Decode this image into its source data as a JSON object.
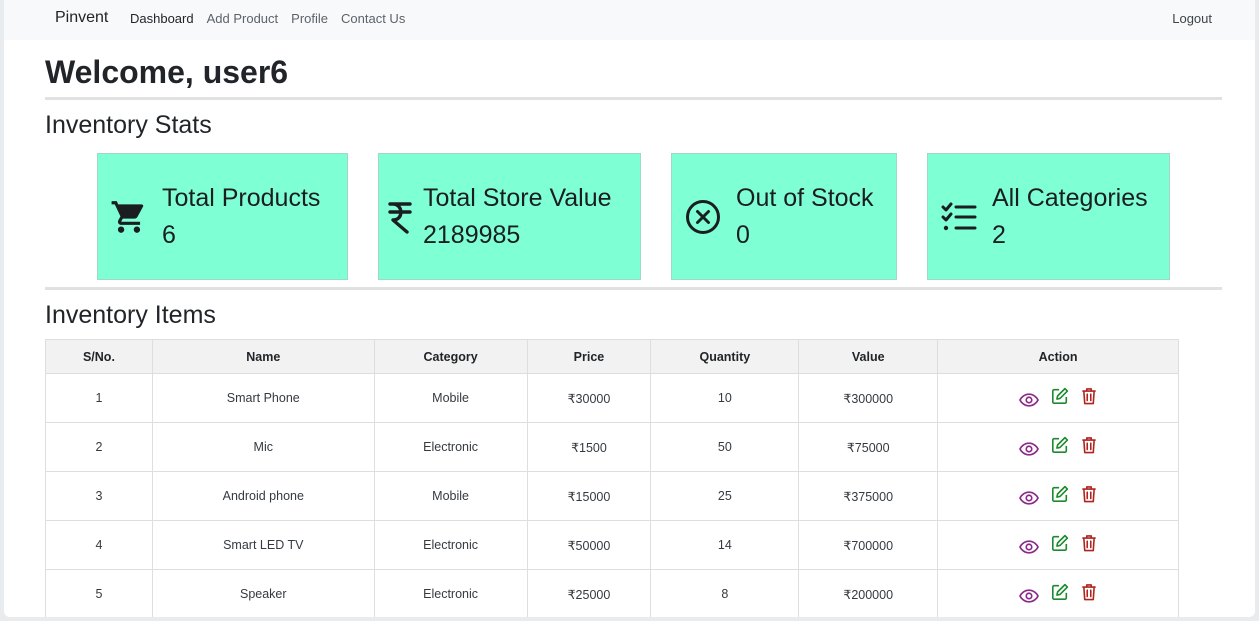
{
  "navbar": {
    "brand": "Pinvent",
    "links": [
      "Dashboard",
      "Add Product",
      "Profile",
      "Contact Us"
    ],
    "logout": "Logout"
  },
  "welcome": "Welcome, user6",
  "stats_heading": "Inventory Stats",
  "stats": [
    {
      "title": "Total Products",
      "value": "6",
      "icon": "cart-icon"
    },
    {
      "title": "Total Store Value",
      "value": "2189985",
      "icon": "rupee-icon"
    },
    {
      "title": "Out of Stock",
      "value": "0",
      "icon": "circle-x-icon"
    },
    {
      "title": "All Categories",
      "value": "2",
      "icon": "checklist-icon"
    }
  ],
  "items_heading": "Inventory Items",
  "table": {
    "headers": [
      "S/No.",
      "Name",
      "Category",
      "Price",
      "Quantity",
      "Value",
      "Action"
    ],
    "rows": [
      [
        "1",
        "Smart Phone",
        "Mobile",
        "₹30000",
        "10",
        "₹300000"
      ],
      [
        "2",
        "Mic",
        "Electronic",
        "₹1500",
        "50",
        "₹75000"
      ],
      [
        "3",
        "Android phone",
        "Mobile",
        "₹15000",
        "25",
        "₹375000"
      ],
      [
        "4",
        "Smart LED TV",
        "Electronic",
        "₹50000",
        "14",
        "₹700000"
      ],
      [
        "5",
        "Speaker",
        "Electronic",
        "₹25000",
        "8",
        "₹200000"
      ]
    ]
  },
  "colors": {
    "card_bg": "#7fffd4",
    "view_icon": "#8a2a8a",
    "edit_icon": "#1e8a2e",
    "delete_icon": "#b0241f"
  }
}
